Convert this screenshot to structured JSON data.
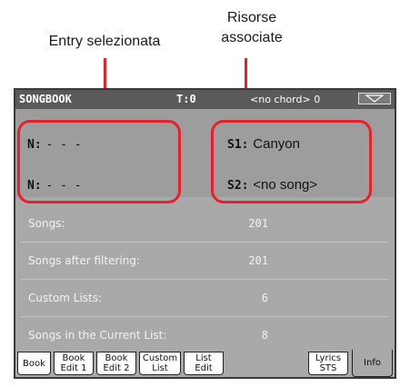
{
  "callouts": {
    "entry": "Entry selezionata",
    "resources_line1": "Risorse",
    "resources_line2": "associate"
  },
  "titlebar": {
    "title": "SONGBOOK",
    "tempo": "T:0",
    "chord": "no chord> 0",
    "menu_icon": "triangle-down-icon"
  },
  "entries": [
    {
      "label": "N:",
      "value": "- - -"
    },
    {
      "label": "N:",
      "value": "- - -"
    }
  ],
  "resources": [
    {
      "label": "S1:",
      "value": "Canyon"
    },
    {
      "label": "S2:",
      "value": "<no song>"
    }
  ],
  "info": [
    {
      "label": "Songs:",
      "value": "201"
    },
    {
      "label": "Songs after filtering:",
      "value": "201"
    },
    {
      "label": "Custom Lists:",
      "value": "6"
    },
    {
      "label": "Songs in the Current List:",
      "value": "8"
    }
  ],
  "tabs": [
    {
      "line1": "Book",
      "line2": ""
    },
    {
      "line1": "Book",
      "line2": "Edit 1"
    },
    {
      "line1": "Book",
      "line2": "Edit 2"
    },
    {
      "line1": "Custom",
      "line2": "List"
    },
    {
      "line1": "List",
      "line2": "Edit"
    },
    {
      "line1": "Lyrics",
      "line2": "STS"
    },
    {
      "line1": "Info",
      "line2": ""
    }
  ],
  "colors": {
    "highlight": "#e8202a",
    "titlebar": "#5a5a5a",
    "screen": "#a9a9a9"
  }
}
